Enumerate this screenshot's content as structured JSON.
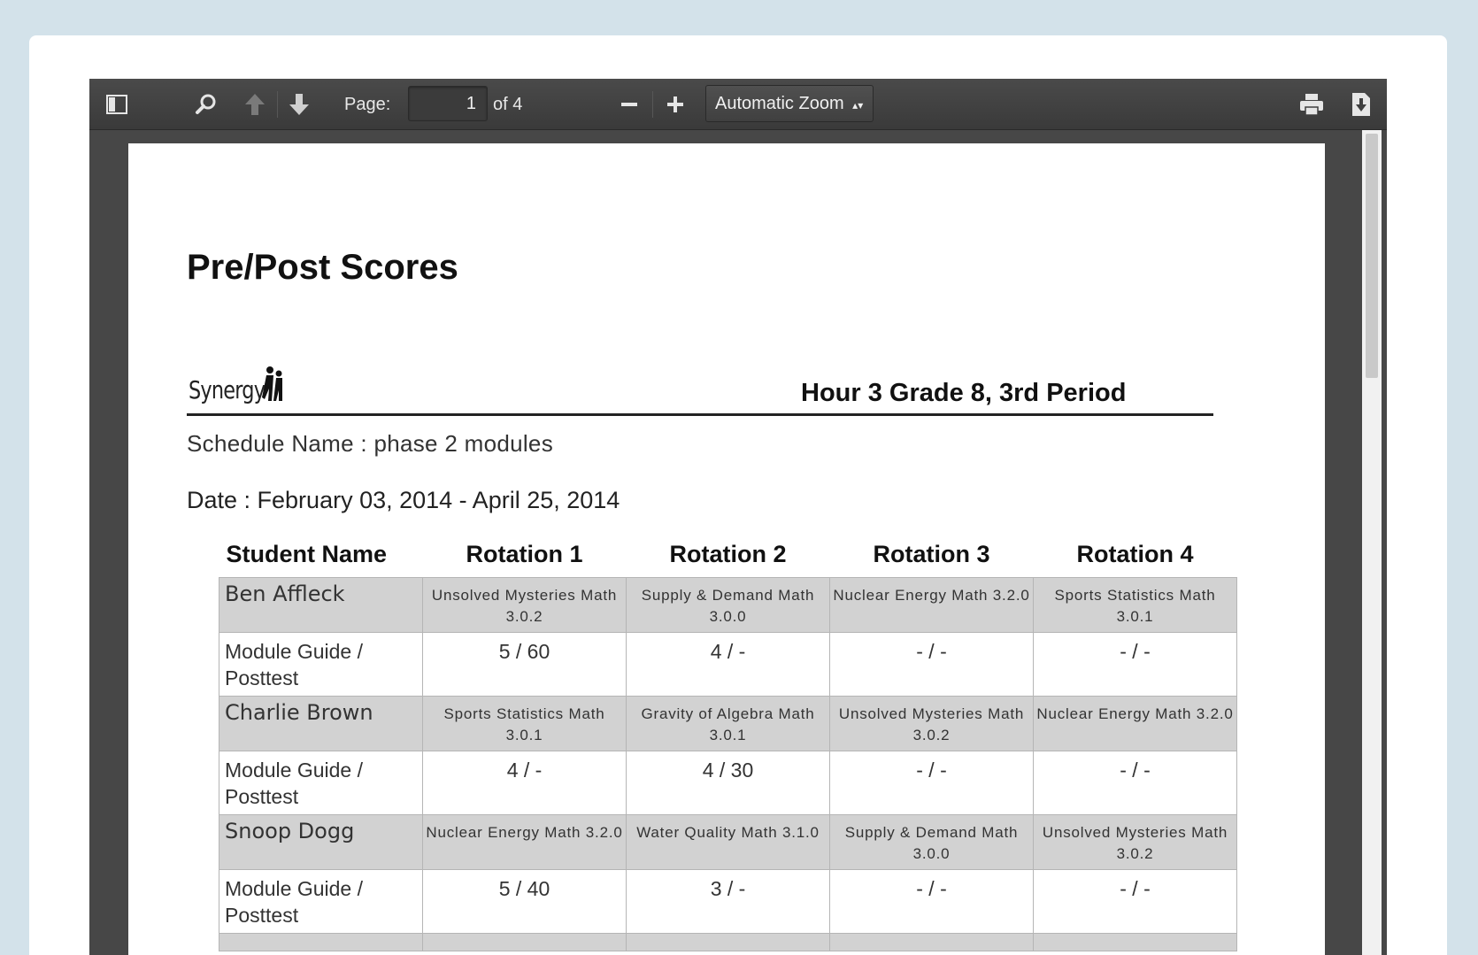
{
  "toolbar": {
    "page_label": "Page:",
    "page_value": "1",
    "page_of": "of 4",
    "zoom": "Automatic Zoom",
    "icons": [
      "sidebar-toggle-icon",
      "search-icon",
      "arrow-up-icon",
      "arrow-down-icon",
      "zoom-out-icon",
      "zoom-in-icon",
      "print-icon",
      "download-icon"
    ]
  },
  "document": {
    "title": "Pre/Post Scores",
    "logo_text": "Synergy",
    "class_title": "Hour 3 Grade 8, 3rd Period",
    "schedule": "Schedule Name : phase 2 modules",
    "date": "Date : February 03, 2014 - April 25, 2014"
  },
  "table": {
    "headers": [
      "Student Name",
      "Rotation 1",
      "Rotation 2",
      "Rotation 3",
      "Rotation 4"
    ],
    "score_label": "Module Guide / Posttest",
    "students": [
      {
        "name": "Ben Affleck",
        "modules": [
          "Unsolved Mysteries Math 3.0.2",
          "Supply & Demand Math 3.0.0",
          "Nuclear Energy Math 3.2.0",
          "Sports Statistics Math 3.0.1"
        ],
        "scores": [
          "5 / 60",
          "4 / -",
          "- / -",
          "- / -"
        ]
      },
      {
        "name": "Charlie Brown",
        "modules": [
          "Sports Statistics Math 3.0.1",
          "Gravity of Algebra Math 3.0.1",
          "Unsolved Mysteries Math 3.0.2",
          "Nuclear Energy Math 3.2.0"
        ],
        "scores": [
          "4 / -",
          "4 / 30",
          "- / -",
          "- / -"
        ]
      },
      {
        "name": "Snoop Dogg",
        "modules": [
          "Nuclear Energy Math 3.2.0",
          "Water Quality Math 3.1.0",
          "Supply & Demand Math 3.0.0",
          "Unsolved Mysteries Math 3.0.2"
        ],
        "scores": [
          "5 / 40",
          "3 / -",
          "- / -",
          "- / -"
        ]
      }
    ]
  }
}
